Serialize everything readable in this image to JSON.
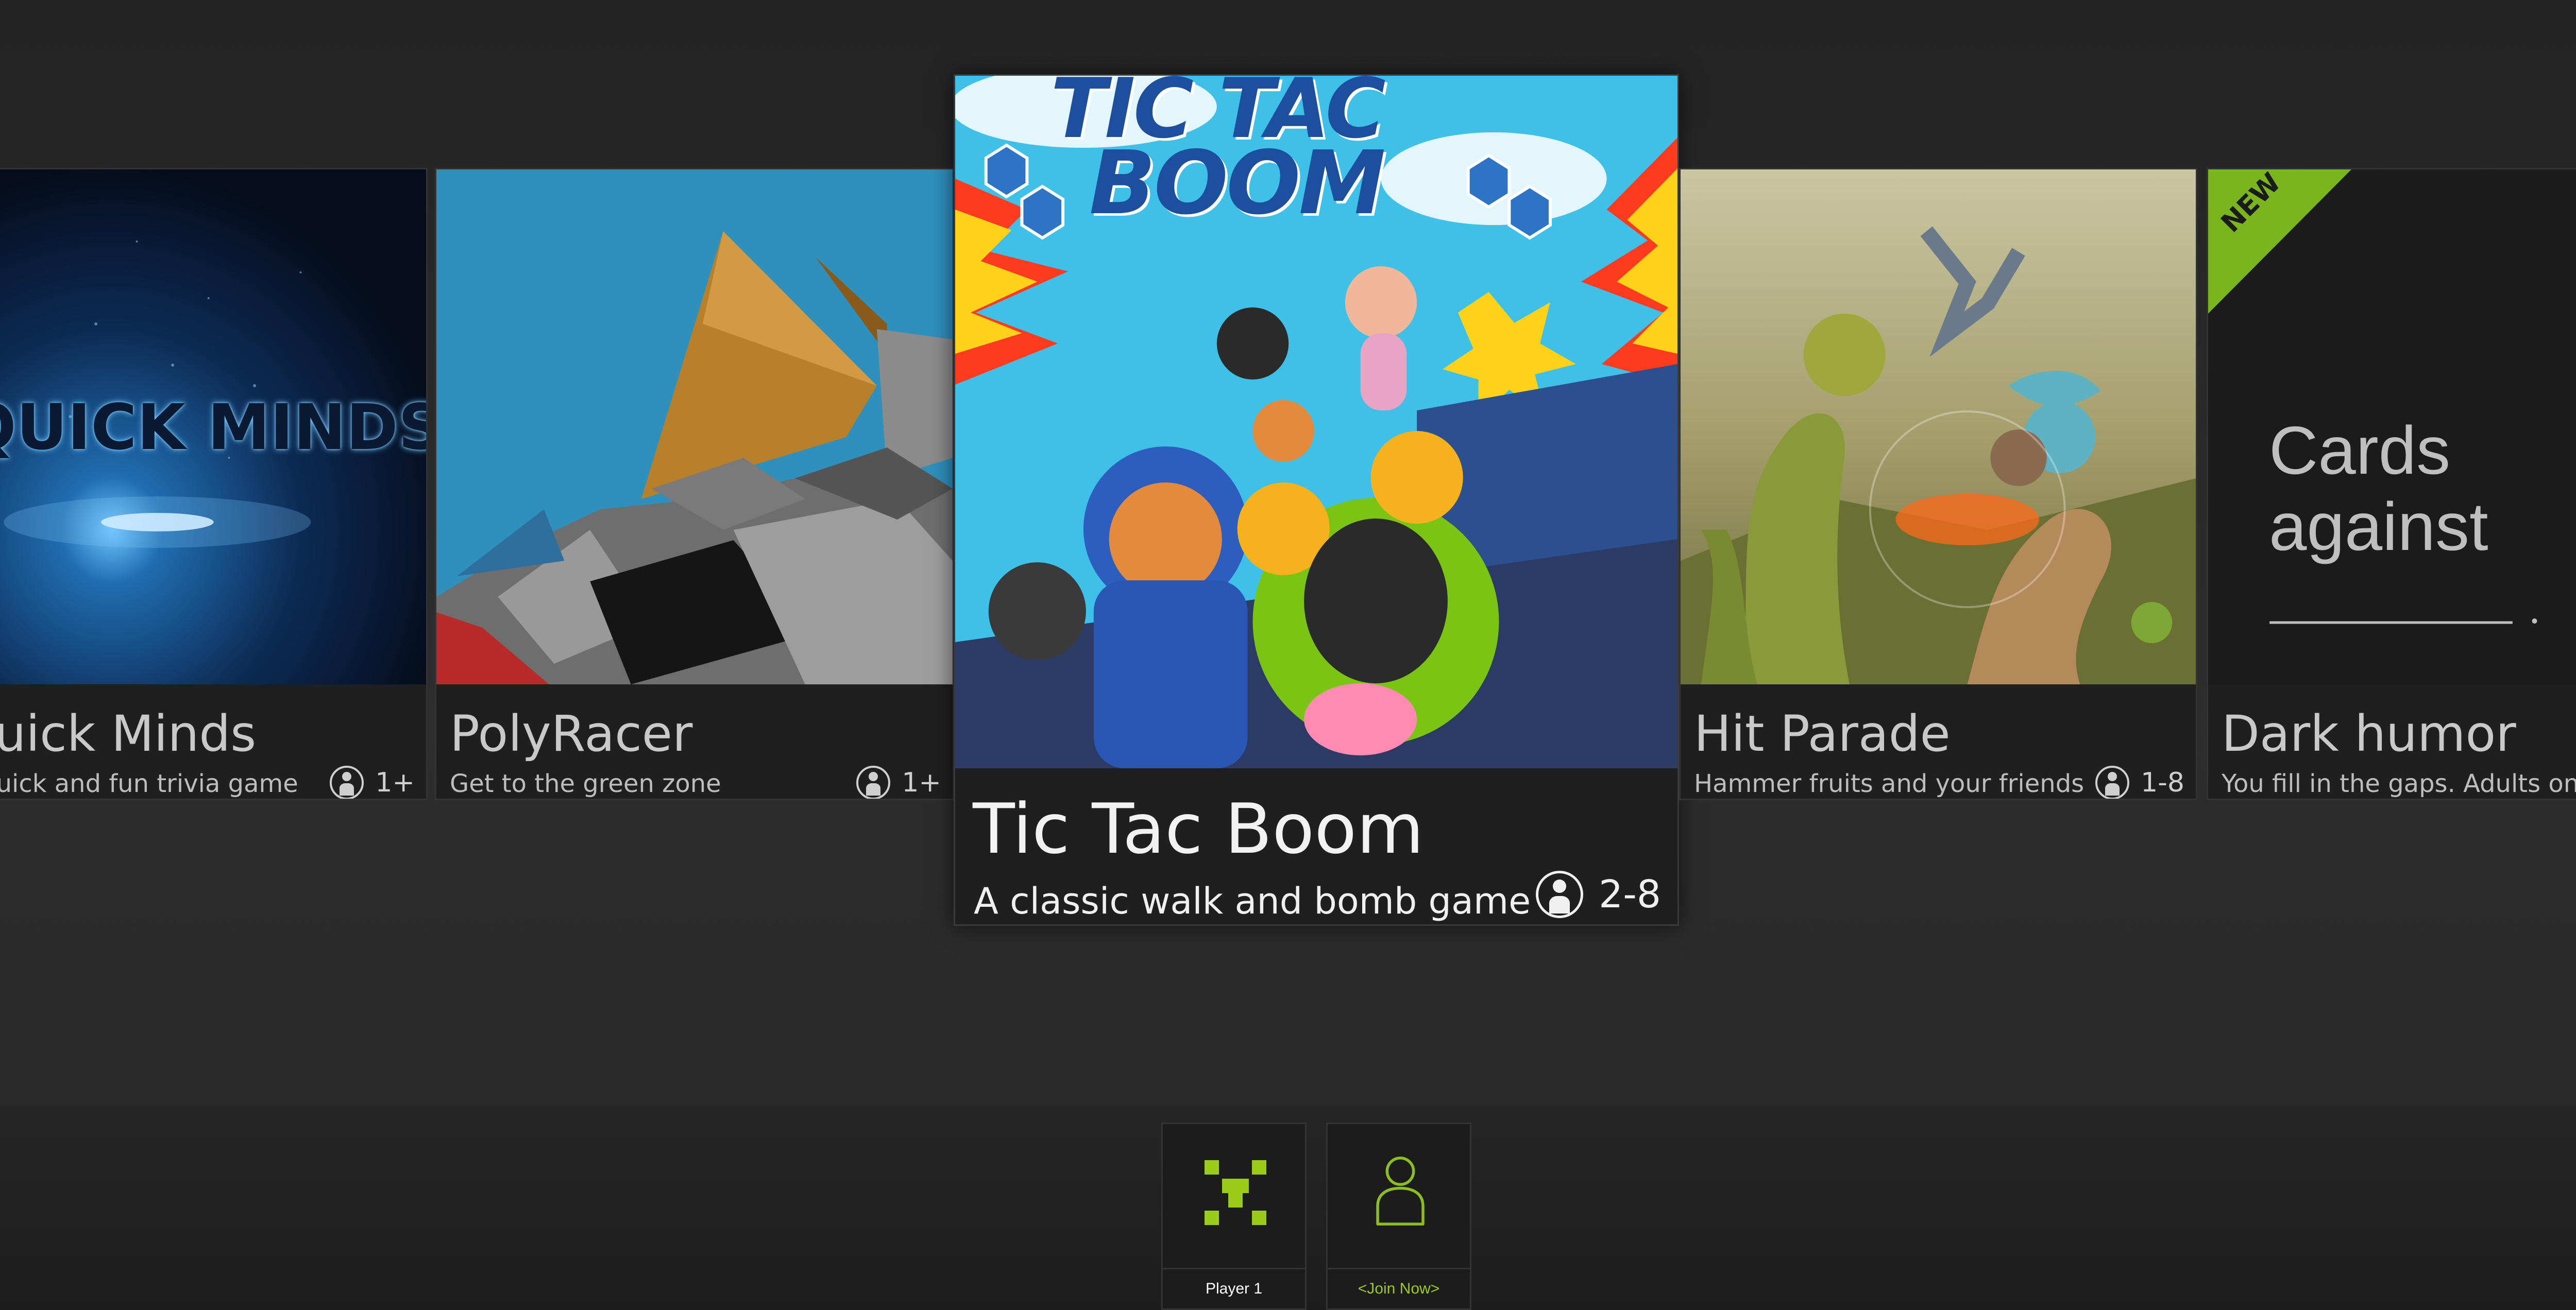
{
  "games": [
    {
      "id": "quick-minds",
      "art_text": "QUICK MINDS",
      "title": "Quick Minds",
      "description": "A quick and fun trivia game",
      "players": "1+"
    },
    {
      "id": "polyracer",
      "title": "PolyRacer",
      "description": "Get to the green zone",
      "players": "1+"
    },
    {
      "id": "tic-tac-boom",
      "art_text_top": "TIC TAC",
      "art_text_bottom": "BOOM",
      "title": "Tic Tac Boom",
      "description": "A classic walk and bomb game",
      "players": "2-8",
      "featured": true
    },
    {
      "id": "hit-parade",
      "title": "Hit Parade",
      "description": "Hammer fruits and your friends",
      "players": "1-8"
    },
    {
      "id": "dark-humor",
      "badge": "NEW",
      "art_line1": "Cards",
      "art_line2": "against",
      "title": "Dark humor",
      "description": "You fill in the gaps. Adults only."
    }
  ],
  "player_slots": [
    {
      "label": "Player 1",
      "icon": "player-glyph-icon",
      "color": "#9ccc1a"
    },
    {
      "label": "<Join Now>",
      "icon": "person-outline-icon",
      "color": "#8cbf1e"
    }
  ],
  "colors": {
    "accent": "#7ab51d",
    "background": "#2a2a2a",
    "card": "#1f1f1f"
  }
}
